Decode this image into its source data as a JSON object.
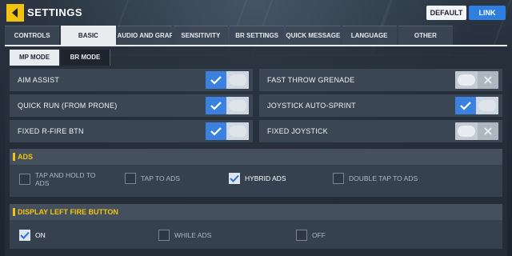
{
  "header": {
    "title": "SETTINGS",
    "default_label": "DEFAULT",
    "link_label": "LINK"
  },
  "tabs": [
    {
      "label": "CONTROLS",
      "active": false
    },
    {
      "label": "BASIC",
      "active": true
    },
    {
      "label": "AUDIO AND GRAPHICS",
      "active": false
    },
    {
      "label": "SENSITIVITY",
      "active": false
    },
    {
      "label": "BR SETTINGS",
      "active": false
    },
    {
      "label": "QUICK MESSAGE",
      "active": false
    },
    {
      "label": "LANGUAGE",
      "active": false
    },
    {
      "label": "OTHER",
      "active": false
    }
  ],
  "subtabs": [
    {
      "label": "MP MODE",
      "active": true
    },
    {
      "label": "BR MODE",
      "active": false
    }
  ],
  "settings": [
    {
      "label": "AIM ASSIST",
      "on": true
    },
    {
      "label": "FAST THROW GRENADE",
      "on": false
    },
    {
      "label": "QUICK RUN (FROM PRONE)",
      "on": true
    },
    {
      "label": "JOYSTICK AUTO-SPRINT",
      "on": true
    },
    {
      "label": "FIXED R-FIRE BTN",
      "on": true
    },
    {
      "label": "FIXED JOYSTICK",
      "on": false
    }
  ],
  "ads": {
    "title": "ADS",
    "options": [
      {
        "label": "TAP AND HOLD TO ADS",
        "checked": false
      },
      {
        "label": "TAP TO ADS",
        "checked": false
      },
      {
        "label": "HYBRID ADS",
        "checked": true
      },
      {
        "label": "DOUBLE TAP TO ADS",
        "checked": false
      }
    ]
  },
  "left_fire": {
    "title": "DISPLAY LEFT FIRE BUTTON",
    "options": [
      {
        "label": "ON",
        "checked": true
      },
      {
        "label": "WHILE ADS",
        "checked": false
      },
      {
        "label": "OFF",
        "checked": false
      }
    ]
  },
  "colors": {
    "accent_yellow": "#f1c40f",
    "toggle_blue": "#3b82e0",
    "link_blue": "#2f7fe0"
  }
}
